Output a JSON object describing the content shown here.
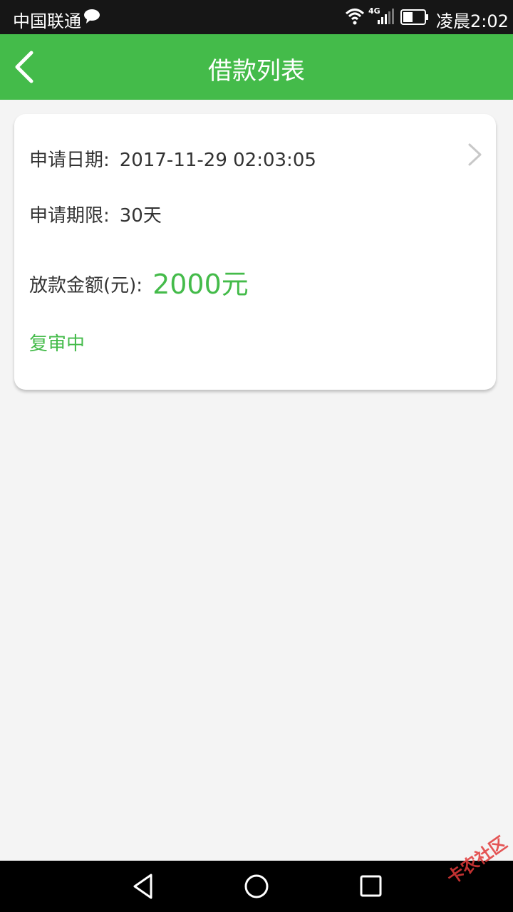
{
  "status_bar": {
    "carrier": "中国联通",
    "network": "4G",
    "time": "凌晨2:02"
  },
  "app_bar": {
    "title": "借款列表",
    "back_icon": "chevron-left-icon",
    "color": "#44bb4a"
  },
  "loan_card": {
    "date_label": "申请日期:",
    "date_value": "2017-11-29 02:03:05",
    "term_label": "申请期限:",
    "term_value": "30天",
    "amount_label": "放款金额(元):",
    "amount_value": "2000元",
    "status": "复审中",
    "chevron_icon": "chevron-right-icon"
  },
  "nav_bar": {
    "back_icon": "triangle-back-icon",
    "home_icon": "circle-home-icon",
    "recent_icon": "square-recent-icon"
  },
  "watermark": "卡农社区"
}
